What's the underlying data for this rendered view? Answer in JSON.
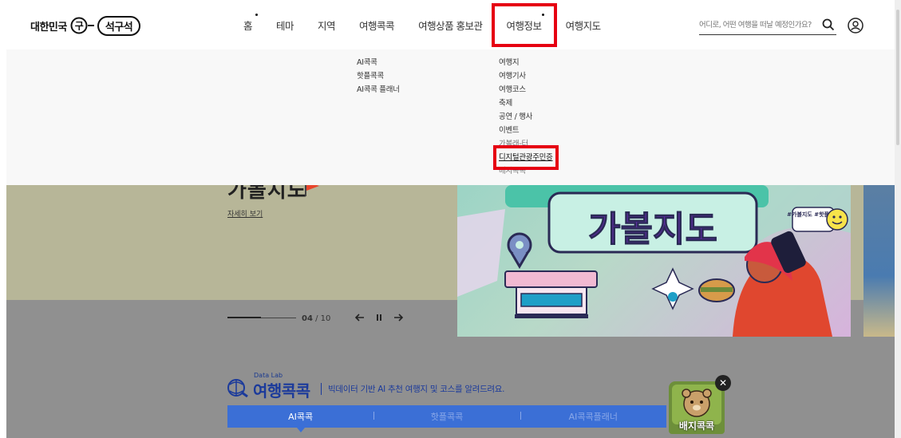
{
  "header": {
    "logo": {
      "part1": "대한민국",
      "mark": "구",
      "part2": "석구석"
    },
    "nav": [
      {
        "label": "홈",
        "dot": true
      },
      {
        "label": "테마",
        "dot": false
      },
      {
        "label": "지역",
        "dot": false
      },
      {
        "label": "여행콕콕",
        "dot": false
      },
      {
        "label": "여행상품 홍보관",
        "dot": false
      },
      {
        "label": "여행정보",
        "dot": true
      },
      {
        "label": "여행지도",
        "dot": false
      }
    ],
    "search": {
      "placeholder": "어디로, 어떤 여행을 떠날 예정인가요?"
    }
  },
  "mega_menu": {
    "col1": [
      "AI콕콕",
      "핫플콕콕",
      "AI콕콕 플래너"
    ],
    "col2": [
      "여행지",
      "여행기사",
      "여행코스",
      "축제",
      "공연 / 행사",
      "이벤트",
      "가볼래-터",
      "디지털관광주민증",
      "배지콕콕"
    ]
  },
  "hero": {
    "title": "가볼지도",
    "more_link": "자세히 보기",
    "pager_current": "04",
    "pager_sep": "/",
    "pager_total": "10",
    "banner_text": "가볼지도",
    "banner_tags": "#가볼지도 #핫플지도"
  },
  "datalab": {
    "sub": "Data Lab",
    "title": "여행콕콕",
    "desc": "빅데이터 기반 AI 추천 여행지 및 코스를 알려드려요.",
    "tabs": [
      "AI콕콕",
      "핫플콕콕",
      "AI콕콕플래너"
    ],
    "badge_label": "배지콕콕"
  },
  "colors": {
    "highlight": "#e60012",
    "brand_blue": "#1b3a9b",
    "tab_blue": "#3b6fd6"
  }
}
